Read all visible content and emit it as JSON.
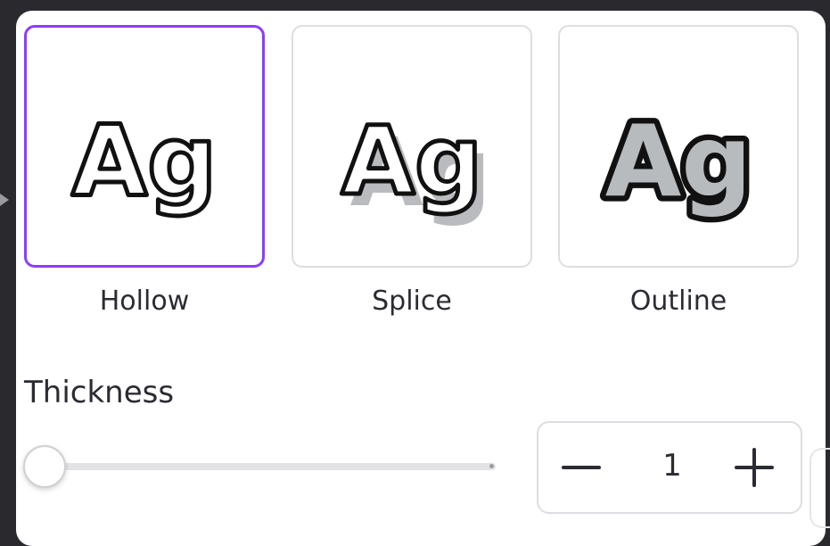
{
  "effects": [
    {
      "label": "Hollow",
      "sample": "Ag",
      "selected": true
    },
    {
      "label": "Splice",
      "sample": "Ag",
      "selected": false
    },
    {
      "label": "Outline",
      "sample": "Ag",
      "selected": false
    }
  ],
  "thickness": {
    "label": "Thickness",
    "value": "1",
    "slider_fraction": 0
  },
  "icons": {
    "decrease": "minus-icon",
    "increase": "plus-icon"
  },
  "colors": {
    "accent": "#8b3dff",
    "text": "#2b2b33",
    "splice_shadow": "#b9bbbf",
    "outline_fill": "#b8bbbe"
  }
}
